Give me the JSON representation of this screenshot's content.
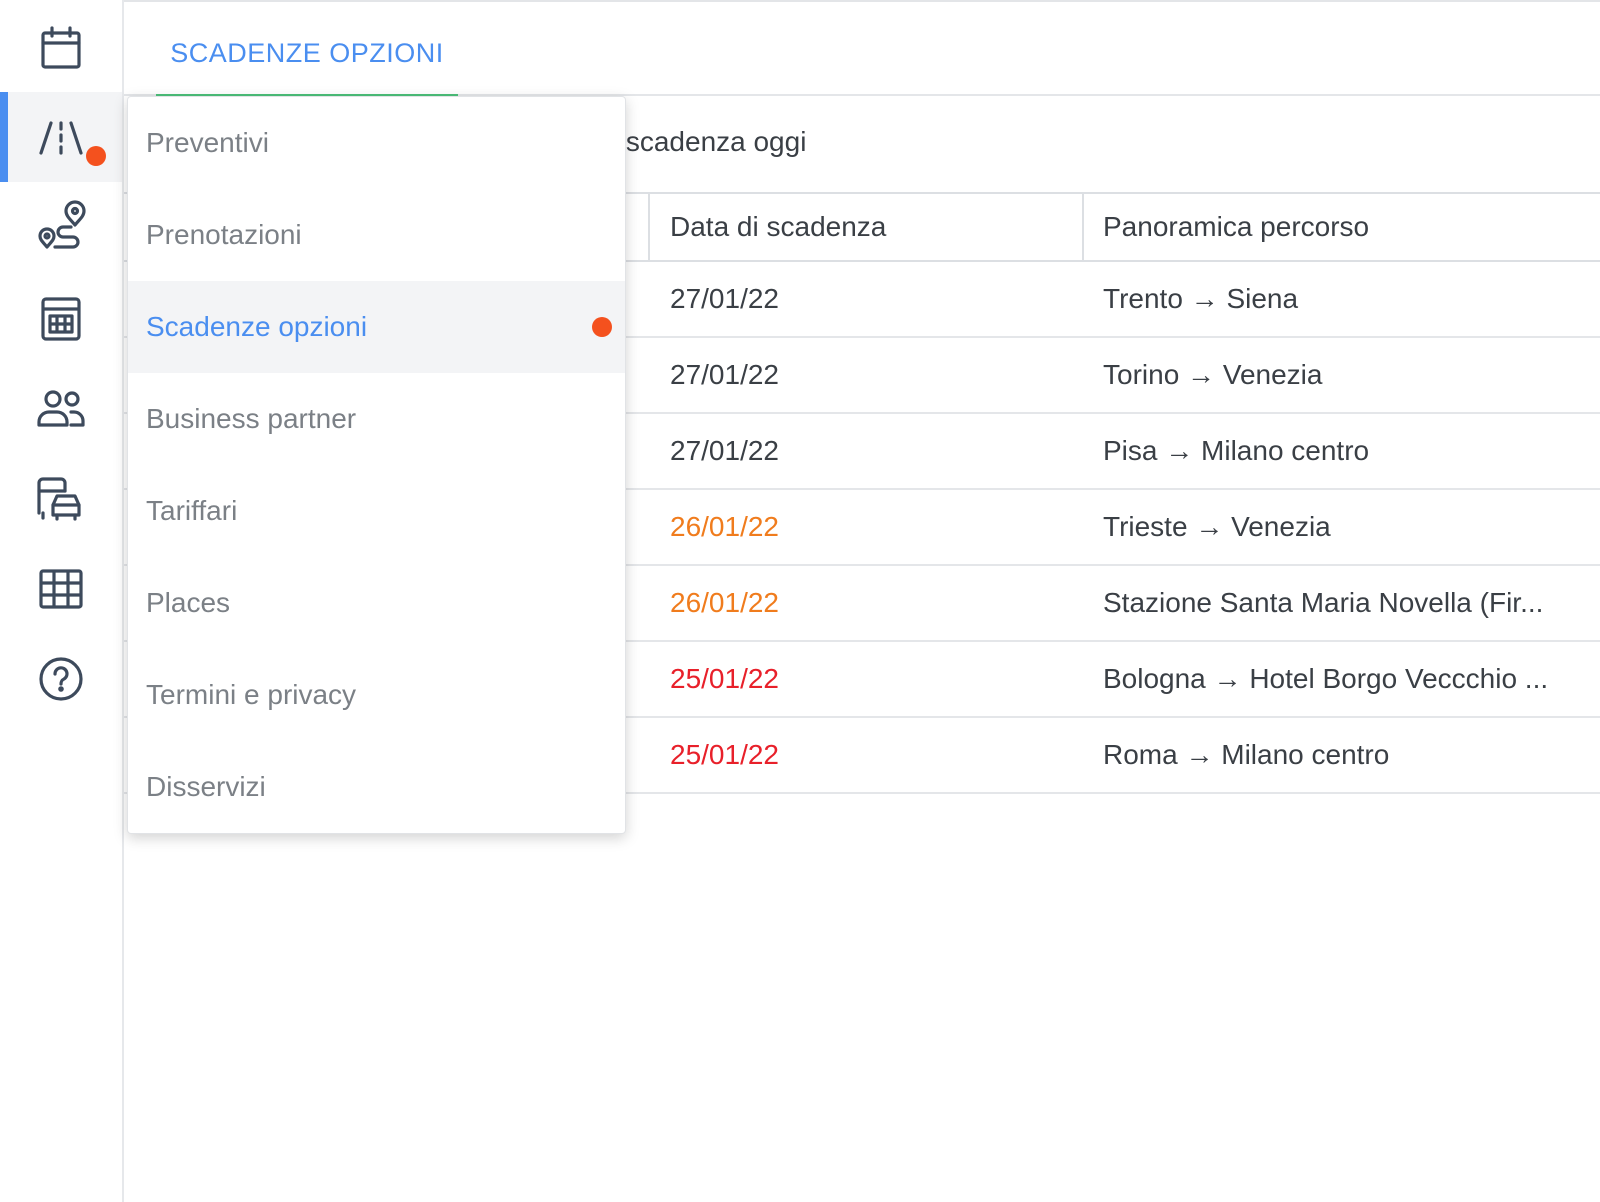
{
  "colors": {
    "accent": "#4a8ef0",
    "tab_underline": "#4cc07a",
    "badge": "#f4511e",
    "date_normal": "#3a3f45",
    "date_warning": "#f07c1d",
    "date_expired": "#e8202a"
  },
  "sidebar": {
    "items": [
      {
        "icon": "calendar-icon"
      },
      {
        "icon": "road-icon",
        "active": true,
        "badge": true
      },
      {
        "icon": "route-icon"
      },
      {
        "icon": "calculator-icon"
      },
      {
        "icon": "users-icon"
      },
      {
        "icon": "vehicles-icon"
      },
      {
        "icon": "grid-icon"
      },
      {
        "icon": "help-icon"
      }
    ]
  },
  "tabs": [
    {
      "label": "SCADENZE OPZIONI",
      "active": true
    }
  ],
  "subtitle": "duti e in scadenza oggi",
  "table": {
    "headers": [
      "Data di scadenza",
      "Panoramica percorso"
    ],
    "rows": [
      {
        "date": "27/01/22",
        "status": "normal",
        "route": "Trento → Siena"
      },
      {
        "date": "27/01/22",
        "status": "normal",
        "route": "Torino → Venezia"
      },
      {
        "date": "27/01/22",
        "status": "normal",
        "route": "Pisa → Milano centro"
      },
      {
        "date": "26/01/22",
        "status": "warning",
        "route": "Trieste → Venezia"
      },
      {
        "date": "26/01/22",
        "status": "warning",
        "route": "Stazione Santa Maria Novella (Fir..."
      },
      {
        "date": "25/01/22",
        "status": "expired",
        "route": "Bologna → Hotel Borgo Veccchio ..."
      },
      {
        "date": "25/01/22",
        "status": "expired",
        "route": "Roma → Milano centro"
      }
    ]
  },
  "menu": {
    "items": [
      {
        "label": "Preventivi"
      },
      {
        "label": "Prenotazioni"
      },
      {
        "label": "Scadenze opzioni",
        "selected": true,
        "badge": true
      },
      {
        "label": "Business partner"
      },
      {
        "label": "Tariffari"
      },
      {
        "label": "Places"
      },
      {
        "label": "Termini e privacy"
      },
      {
        "label": "Disservizi"
      }
    ]
  }
}
